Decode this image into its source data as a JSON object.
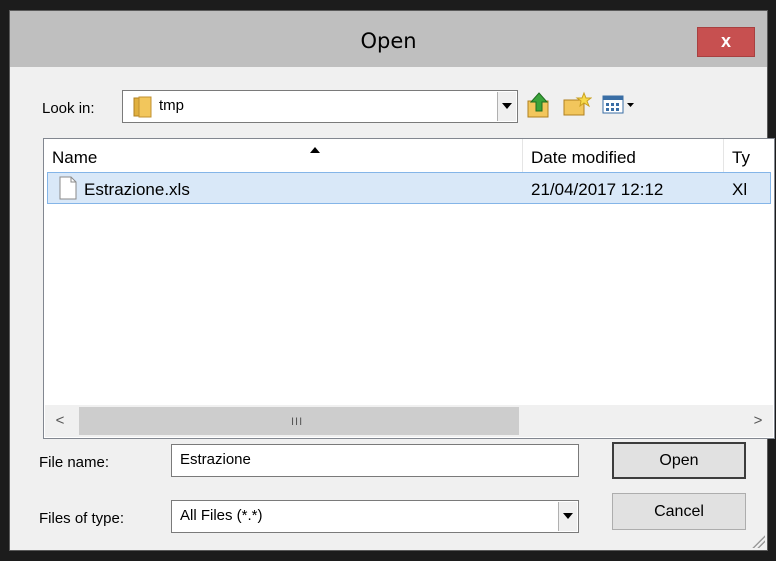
{
  "window": {
    "title": "Open",
    "close_label": "x"
  },
  "look_in": {
    "label": "Look in:",
    "value": "tmp"
  },
  "list": {
    "columns": [
      "Name",
      "Date modified",
      "Ty"
    ],
    "rows": [
      {
        "name": "Estrazione.xls",
        "date": "21/04/2017 12:12",
        "type": "Xl"
      }
    ]
  },
  "scrollbar": {
    "left_arrow": "<",
    "right_arrow": ">",
    "grip": "III"
  },
  "file_name": {
    "label": "File name:",
    "value": "Estrazione"
  },
  "file_type": {
    "label": "Files of type:",
    "value": "All Files (*.*)"
  },
  "buttons": {
    "open": "Open",
    "cancel": "Cancel"
  },
  "icons": {
    "folder": "folder-icon",
    "up": "up-folder-icon",
    "new_folder": "new-folder-icon",
    "view": "view-menu-icon",
    "file": "file-icon"
  }
}
